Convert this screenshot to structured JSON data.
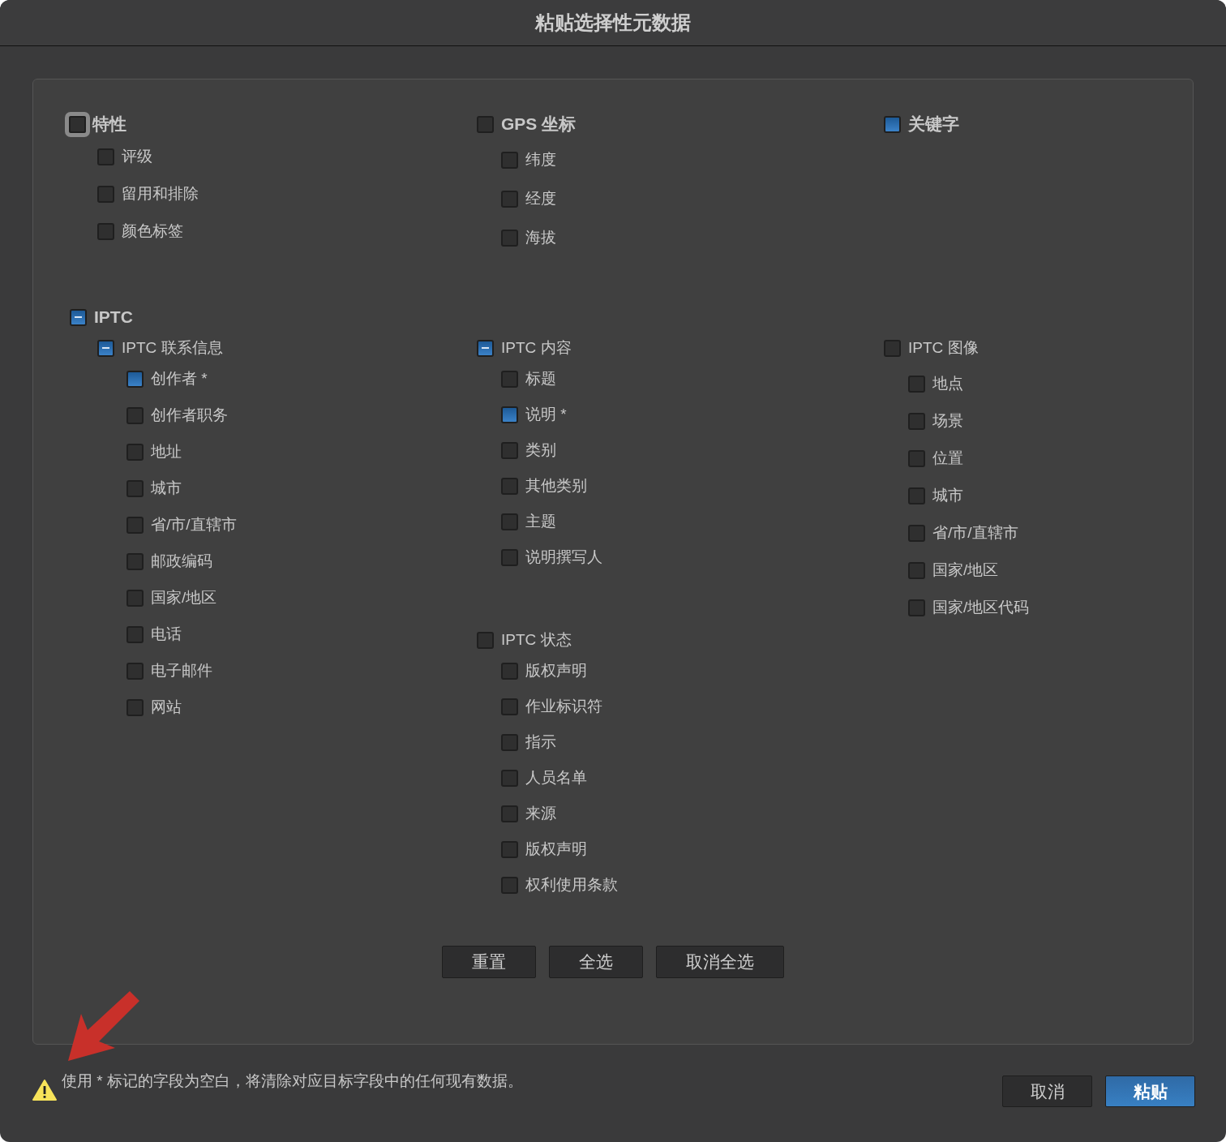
{
  "title": "粘贴选择性元数据",
  "top_groups": [
    {
      "label": "特性",
      "checked": false,
      "mixed": false,
      "focused": true,
      "items": [
        {
          "label": "评级",
          "checked": false
        },
        {
          "label": "留用和排除",
          "checked": false
        },
        {
          "label": "颜色标签",
          "checked": false
        }
      ]
    },
    {
      "label": "GPS 坐标",
      "checked": false,
      "mixed": false,
      "focused": false,
      "items": [
        {
          "label": "纬度",
          "checked": false
        },
        {
          "label": "经度",
          "checked": false
        },
        {
          "label": "海拔",
          "checked": false
        }
      ]
    },
    {
      "label": "关键字",
      "checked": true,
      "mixed": false,
      "focused": false
    }
  ],
  "iptc": {
    "label": "IPTC",
    "mixed": true,
    "columns": [
      [
        {
          "label": "IPTC 联系信息",
          "mixed": true,
          "items": [
            {
              "label": "创作者 *",
              "checked": true
            },
            {
              "label": "创作者职务",
              "checked": false
            },
            {
              "label": "地址",
              "checked": false
            },
            {
              "label": "城市",
              "checked": false
            },
            {
              "label": "省/市/直辖市",
              "checked": false
            },
            {
              "label": "邮政编码",
              "checked": false
            },
            {
              "label": "国家/地区",
              "checked": false
            },
            {
              "label": "电话",
              "checked": false
            },
            {
              "label": "电子邮件",
              "checked": false
            },
            {
              "label": "网站",
              "checked": false
            }
          ]
        }
      ],
      [
        {
          "label": "IPTC 内容",
          "mixed": true,
          "items": [
            {
              "label": "标题",
              "checked": false
            },
            {
              "label": "说明 *",
              "checked": true
            },
            {
              "label": "类别",
              "checked": false
            },
            {
              "label": "其他类别",
              "checked": false
            },
            {
              "label": "主题",
              "checked": false
            },
            {
              "label": "说明撰写人",
              "checked": false
            }
          ]
        },
        {
          "label": "IPTC 状态",
          "checked": false,
          "mixed": false,
          "items": [
            {
              "label": "版权声明",
              "checked": false
            },
            {
              "label": "作业标识符",
              "checked": false
            },
            {
              "label": "指示",
              "checked": false
            },
            {
              "label": "人员名单",
              "checked": false
            },
            {
              "label": "来源",
              "checked": false
            },
            {
              "label": "版权声明",
              "checked": false
            },
            {
              "label": "权利使用条款",
              "checked": false
            }
          ]
        }
      ],
      [
        {
          "label": "IPTC 图像",
          "checked": false,
          "mixed": false,
          "items": [
            {
              "label": "地点",
              "checked": false
            },
            {
              "label": "场景",
              "checked": false
            },
            {
              "label": "位置",
              "checked": false
            },
            {
              "label": "城市",
              "checked": false
            },
            {
              "label": "省/市/直辖市",
              "checked": false
            },
            {
              "label": "国家/地区",
              "checked": false
            },
            {
              "label": "国家/地区代码",
              "checked": false
            }
          ]
        }
      ]
    ]
  },
  "buttons": [
    {
      "label": "重置"
    },
    {
      "label": "全选"
    },
    {
      "label": "取消全选"
    }
  ],
  "notice": "使用 * 标记的字段为空白，将清除对应目标字段中的任何现有数据。",
  "actions": [
    {
      "label": "取消",
      "primary": false
    },
    {
      "label": "粘贴",
      "primary": true
    }
  ]
}
